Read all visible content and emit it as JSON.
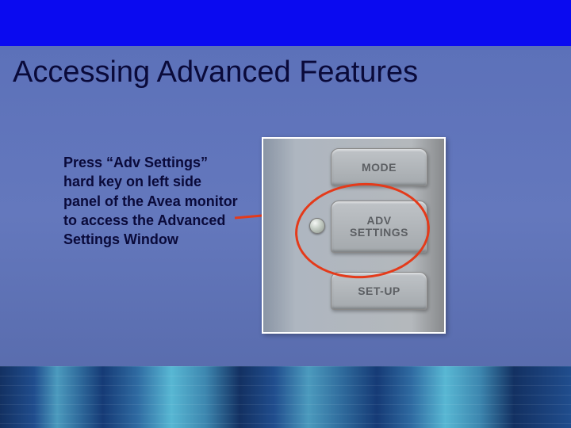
{
  "title": "Accessing Advanced Features",
  "instruction": "Press “Adv Settings” hard key on left side panel of the Avea monitor to access the Advanced Settings Window",
  "panel": {
    "buttons": {
      "mode": "MODE",
      "adv_line1": "ADV",
      "adv_line2": "SETTINGS",
      "setup": "SET-UP"
    }
  },
  "annotation": {
    "arrow_color": "#e43a1a",
    "circle_color": "#e43a1a"
  }
}
